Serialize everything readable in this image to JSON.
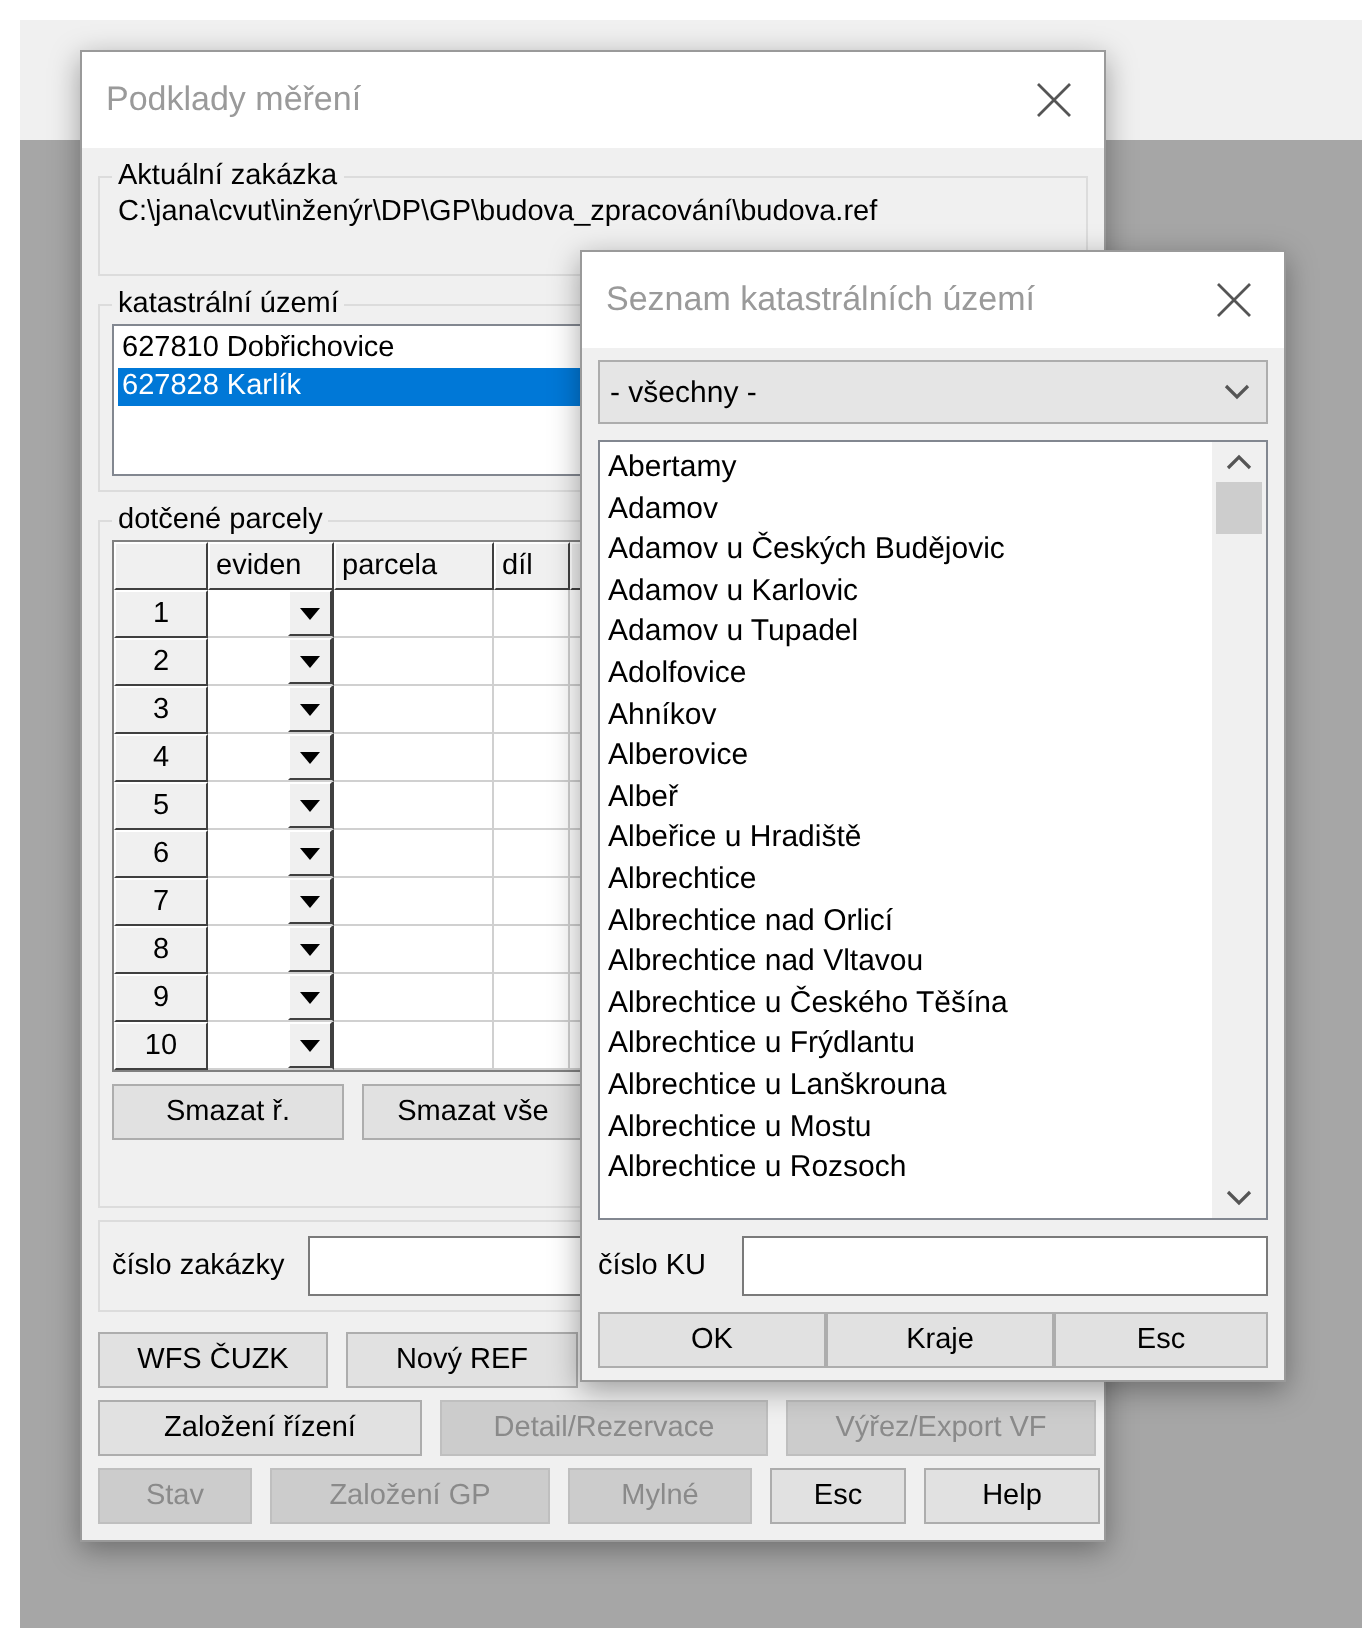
{
  "window": {
    "title": "Podklady měření"
  },
  "current_job": {
    "label": "Aktuální zakázka",
    "path": "C:\\jana\\cvut\\inženýr\\DP\\GP\\budova_zpracování\\budova.ref"
  },
  "cadastral": {
    "label": "katastrální území",
    "items": [
      {
        "text": "627810 Dobřichovice",
        "selected": false
      },
      {
        "text": "627828 Karlík",
        "selected": true
      }
    ]
  },
  "parcels": {
    "label": "dotčené parcely",
    "columns": [
      "eviden",
      "parcela",
      "díl"
    ],
    "rows": [
      "1",
      "2",
      "3",
      "4",
      "5",
      "6",
      "7",
      "8",
      "9",
      "10"
    ],
    "buttons": [
      "Smazat ř.",
      "Smazat vše"
    ]
  },
  "job_number": {
    "label": "číslo zakázky"
  },
  "button_rows": [
    [
      {
        "label": "WFS ČUZK",
        "disabled": false
      },
      {
        "label": "Nový REF",
        "disabled": false
      }
    ],
    [
      {
        "label": "Založení řízení",
        "disabled": false
      },
      {
        "label": "Detail/Rezervace",
        "disabled": true
      },
      {
        "label": "Výřez/Export VF",
        "disabled": true
      }
    ],
    [
      {
        "label": "Stav",
        "disabled": true
      },
      {
        "label": "Založení GP",
        "disabled": true
      },
      {
        "label": "Mylné",
        "disabled": true
      },
      {
        "label": "Esc",
        "disabled": false
      },
      {
        "label": "Help",
        "disabled": false
      }
    ]
  ],
  "dialog": {
    "title": "Seznam katastrálních území",
    "filter": "- všechny -",
    "items": [
      "Abertamy",
      "Adamov",
      "Adamov u Českých Budějovic",
      "Adamov u Karlovic",
      "Adamov u Tupadel",
      "Adolfovice",
      "Ahníkov",
      "Alberovice",
      "Albeř",
      "Albeřice u Hradiště",
      "Albrechtice",
      "Albrechtice nad Orlicí",
      "Albrechtice nad Vltavou",
      "Albrechtice u Českého Těšína",
      "Albrechtice u Frýdlantu",
      "Albrechtice u Lanškrouna",
      "Albrechtice u Mostu",
      "Albrechtice u Rozsoch"
    ],
    "ku_label": "číslo KU",
    "buttons": [
      "OK",
      "Kraje",
      "Esc"
    ]
  }
}
